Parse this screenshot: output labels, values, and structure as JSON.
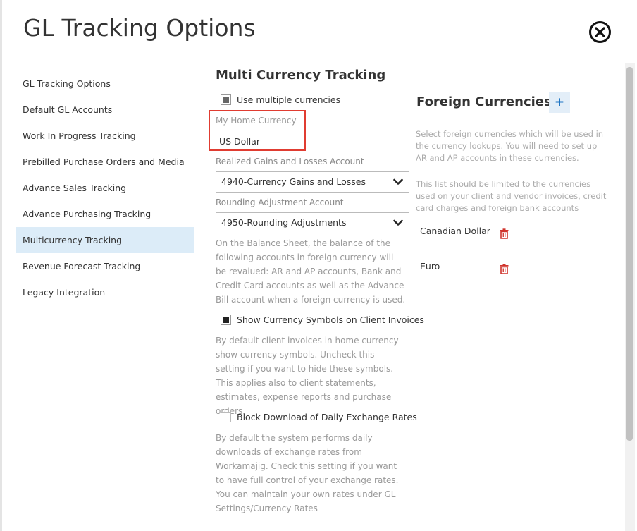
{
  "title": "GL Tracking Options",
  "sidebar": {
    "items": [
      {
        "label": "GL Tracking Options"
      },
      {
        "label": "Default GL Accounts"
      },
      {
        "label": "Work In Progress Tracking"
      },
      {
        "label": "Prebilled Purchase Orders and Media"
      },
      {
        "label": "Advance Sales Tracking"
      },
      {
        "label": "Advance Purchasing Tracking"
      },
      {
        "label": "Multicurrency Tracking"
      },
      {
        "label": "Revenue Forecast Tracking"
      },
      {
        "label": "Legacy Integration"
      }
    ],
    "active_index": 6
  },
  "main": {
    "section_title": "Multi Currency Tracking",
    "use_multiple": {
      "label": "Use multiple currencies",
      "checked": true
    },
    "home_currency": {
      "label": "My Home Currency",
      "value": "US Dollar"
    },
    "realized": {
      "label": "Realized Gains and Losses Account",
      "value": "4940-Currency Gains and Losses"
    },
    "rounding": {
      "label": "Rounding Adjustment Account",
      "value": "4950-Rounding Adjustments"
    },
    "balance_help": "On the Balance Sheet, the balance of the following accounts in foreign currency will be revalued: AR and AP accounts, Bank and Credit Card accounts as well as the Advance Bill account when a foreign currency is used.",
    "show_symbols": {
      "label": "Show Currency Symbols on Client Invoices",
      "checked": true
    },
    "symbols_help": "By default client invoices in home currency show currency symbols. Uncheck this setting if you want to hide these symbols. This applies also to client statements, estimates, expense reports and purchase orders.",
    "block_download": {
      "label": "Block Download of Daily Exchange Rates",
      "checked": false
    },
    "block_help": "By default the system performs daily downloads of exchange rates from Workamajig. Check this setting if you want to have full control of your exchange rates. You can maintain your own rates under GL Settings/Currency Rates"
  },
  "foreign": {
    "title": "Foreign Currencies",
    "add_label": "+",
    "help1": "Select foreign currencies which will be used in the currency lookups. You will need to set up AR and AP accounts in these currencies.",
    "help2": "This list should be limited to the currencies used on your client and vendor invoices, credit card charges and foreign bank accounts",
    "currencies": [
      {
        "name": "Canadian Dollar"
      },
      {
        "name": "Euro"
      }
    ]
  },
  "colors": {
    "accent": "#1c74c3",
    "highlight_border": "#e03c31",
    "active_bg": "#dcecf8",
    "trash": "#d0342c"
  },
  "icons": {
    "close": "close-circle-icon",
    "add": "plus-icon",
    "delete": "trash-icon",
    "dropdown": "chevron-down-icon"
  }
}
